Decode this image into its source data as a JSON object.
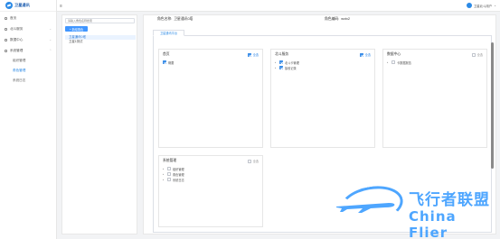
{
  "app": {
    "title": "卫星通讯"
  },
  "colors": {
    "accent": "#2b8ae6",
    "primary_button": "#4096ff",
    "watermark": "#4ea6ff"
  },
  "sidebar": {
    "items": [
      {
        "label": "首页",
        "icon": "home-icon",
        "expandable": false
      },
      {
        "label": "北斗服务",
        "icon": "satellite-icon",
        "expandable": true
      },
      {
        "label": "数据中心",
        "icon": "database-icon",
        "expandable": true
      },
      {
        "label": "系统管理",
        "icon": "gear-icon",
        "expandable": true
      }
    ],
    "sub_items": [
      {
        "label": "组织管理",
        "active": false
      },
      {
        "label": "角色管理",
        "active": true
      },
      {
        "label": "系统日志",
        "active": false
      }
    ]
  },
  "topbar": {
    "menu_icon": "menu-icon",
    "user_label": "卫星北斗用户"
  },
  "role_panel": {
    "search_placeholder": "请输入角色名称搜索",
    "add_button": "+ 新增角色",
    "roles": [
      {
        "label": "卫星通讯0塔",
        "active": true
      },
      {
        "label": "卫星1测试",
        "active": false
      }
    ]
  },
  "main": {
    "role_name_label": "角色名称:",
    "role_name_value": "卫星通讯0塔",
    "role_code_label": "角色编码:",
    "role_code_value": "wxtx2",
    "tab_label": "卫星通讯平台"
  },
  "cards": [
    {
      "title": "首页",
      "select_all": "全选",
      "select_all_checked": true,
      "items": [
        {
          "label": "概要",
          "checked": true,
          "arrow": false
        }
      ]
    },
    {
      "title": "北斗服务",
      "select_all": "全选",
      "select_all_checked": true,
      "items": [
        {
          "label": "北斗卡管理",
          "checked": true,
          "arrow": true
        },
        {
          "label": "接收记录",
          "checked": true,
          "arrow": true
        }
      ]
    },
    {
      "title": "数据中心",
      "select_all": "全选",
      "select_all_checked": false,
      "items": [
        {
          "label": "卡数据报告",
          "checked": false,
          "arrow": true
        }
      ]
    },
    {
      "title": "系统管理",
      "select_all": "全选",
      "select_all_checked": false,
      "items": [
        {
          "label": "组织管理",
          "checked": false,
          "arrow": true
        },
        {
          "label": "角色管理",
          "checked": false,
          "arrow": true
        },
        {
          "label": "系统日志",
          "checked": false,
          "arrow": true
        }
      ]
    }
  ],
  "watermark": {
    "cn": "飞行者联盟",
    "en": "China Flier"
  }
}
